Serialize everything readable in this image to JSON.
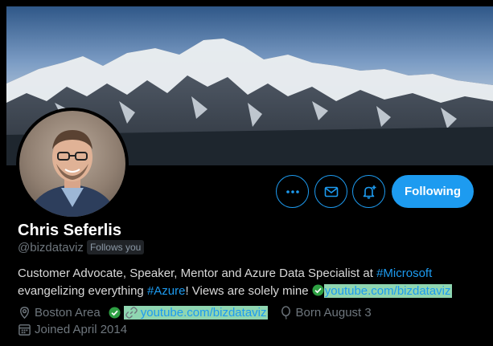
{
  "profile": {
    "name": "Chris Seferlis",
    "handle": "@bizdataviz",
    "follows_you": "Follows you",
    "following_label": "Following"
  },
  "bio": {
    "part1": "Customer Advocate, Speaker, Mentor and Azure Data Specialist at ",
    "hashtag1": "#Microsoft",
    "part2": "evangelizing everything ",
    "hashtag2": "#Azure",
    "part3": "! Views are solely mine ",
    "link": "youtube.com/bizdataviz"
  },
  "meta": {
    "location": "Boston Area",
    "website": "youtube.com/bizdataviz",
    "born": "Born August 3",
    "joined": "Joined April 2014"
  },
  "icons": {
    "more": "more-icon",
    "message": "mail-icon",
    "notify": "bell-plus-icon",
    "location": "location-pin-icon",
    "link": "link-icon",
    "born": "balloon-icon",
    "joined": "calendar-icon",
    "check": "check-circle-icon"
  },
  "colors": {
    "accent": "#1d9bf0",
    "muted": "#6e767d",
    "highlight": "#8fd6b1",
    "check_green": "#2ea043"
  }
}
